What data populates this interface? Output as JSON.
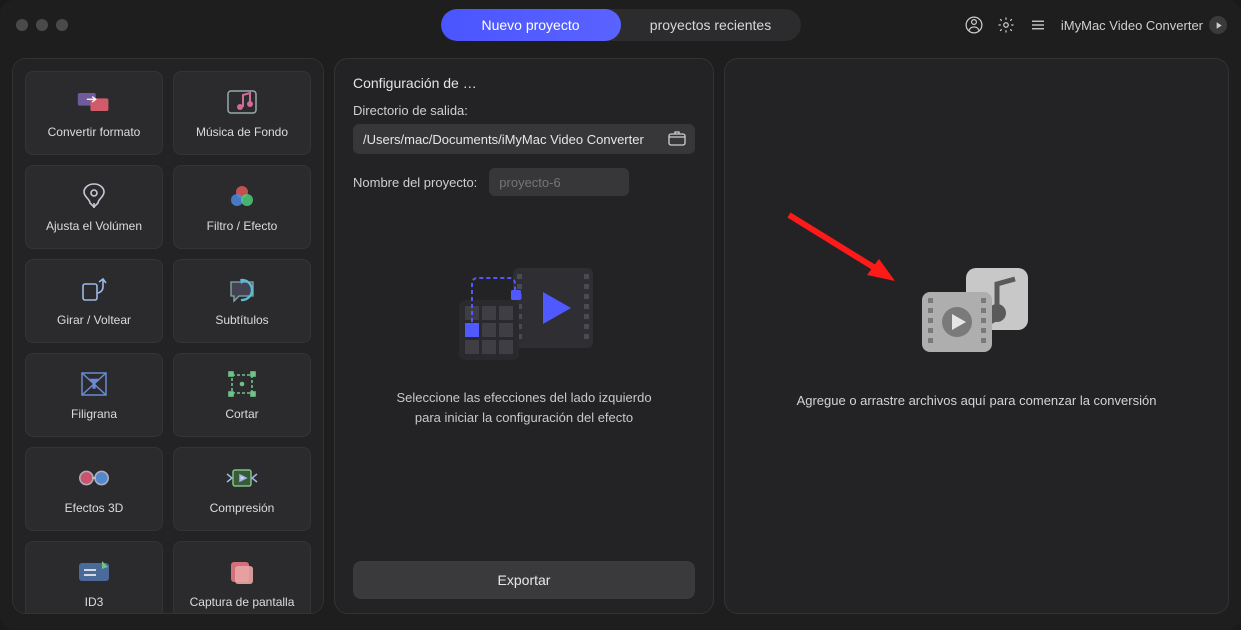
{
  "titlebar": {
    "tabs": {
      "new_project": "Nuevo proyecto",
      "recent_projects": "proyectos recientes"
    },
    "app_name": "iMyMac Video Converter"
  },
  "sidebar": {
    "tools": [
      {
        "id": "convert-format",
        "label": "Convertir formato"
      },
      {
        "id": "background-music",
        "label": "Música de Fondo"
      },
      {
        "id": "adjust-volume",
        "label": "Ajusta el Volúmen"
      },
      {
        "id": "filter-effect",
        "label": "Filtro / Efecto"
      },
      {
        "id": "rotate-flip",
        "label": "Girar / Voltear"
      },
      {
        "id": "subtitles",
        "label": "Subtítulos"
      },
      {
        "id": "watermark",
        "label": "Filigrana"
      },
      {
        "id": "crop",
        "label": "Cortar"
      },
      {
        "id": "effects-3d",
        "label": "Efectos 3D"
      },
      {
        "id": "compression",
        "label": "Compresión"
      },
      {
        "id": "id3",
        "label": "ID3"
      },
      {
        "id": "screenshot",
        "label": "Captura de pantalla"
      }
    ]
  },
  "config": {
    "section_title": "Configuración de …",
    "output_dir_label": "Directorio de salida:",
    "output_dir_value": "/Users/mac/Documents/iMyMac Video Converter",
    "project_name_label": "Nombre del proyecto:",
    "project_name_placeholder": "proyecto-6",
    "effect_hint_line1": "Seleccione las efecciones del lado izquierdo",
    "effect_hint_line2": "para iniciar la configuración del efecto",
    "export_label": "Exportar"
  },
  "dropzone": {
    "hint": "Agregue o arrastre archivos aquí para comenzar la conversión"
  },
  "colors": {
    "accent": "#4f59ff",
    "panel": "#232325",
    "tool": "#2b2b2d"
  }
}
